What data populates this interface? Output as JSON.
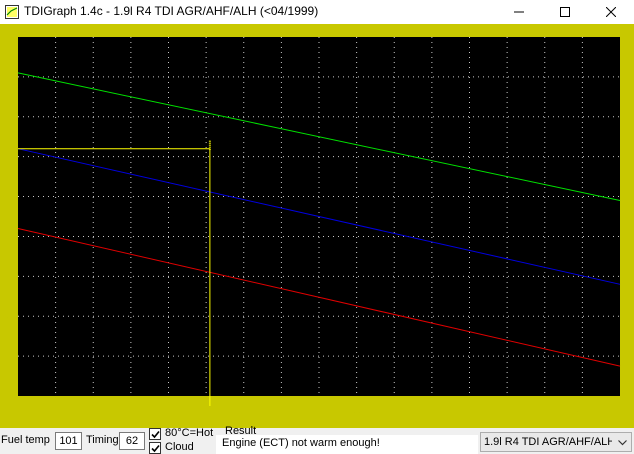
{
  "window": {
    "title": "TDIGraph 1.4c - 1.9l R4 TDI AGR/AHF/ALH (<04/1999)",
    "buttons": [
      "minimize",
      "maximize",
      "close"
    ]
  },
  "colors": {
    "plot_bg": "#000000",
    "frame": "#c8c800",
    "grid": "#c8c8c8",
    "tick_text": "#c8c800",
    "cursor": "#ffff00"
  },
  "chart_data": {
    "type": "line",
    "xlim": [
      50,
      210
    ],
    "ylim": [
      0,
      90
    ],
    "xticks": [
      "50",
      "60",
      "70",
      "80",
      "90",
      "100",
      "110",
      "120",
      "130",
      "140",
      "150",
      "160",
      "170",
      "180",
      "190",
      "200",
      "210"
    ],
    "yticks": [
      "0",
      "10",
      "20",
      "30",
      "40",
      "50",
      "60",
      "70",
      "80",
      "90"
    ],
    "grid": true,
    "series": [
      {
        "color": "#00e000",
        "x": [
          50,
          210
        ],
        "y": [
          81,
          49
        ]
      },
      {
        "color": "#0000e0",
        "x": [
          50,
          210
        ],
        "y": [
          62,
          28
        ]
      },
      {
        "color": "#e00000",
        "x": [
          50,
          210
        ],
        "y": [
          42,
          7.5
        ]
      }
    ],
    "cursor": {
      "x": 101,
      "y": 62
    }
  },
  "controls": {
    "fuel_temp_label": "Fuel temp",
    "fuel_temp_value": "101",
    "timing_label": "Timing",
    "timing_value": "62",
    "check_hot_label": "80°C=Hot",
    "check_hot_checked": true,
    "check_cloud_label": "Cloud",
    "check_cloud_checked": true,
    "result_label": "Result",
    "result_text": "Engine (ECT) not warm enough!",
    "engine_select_value": "1.9l R4 TDI AGR/AHF/ALH"
  }
}
